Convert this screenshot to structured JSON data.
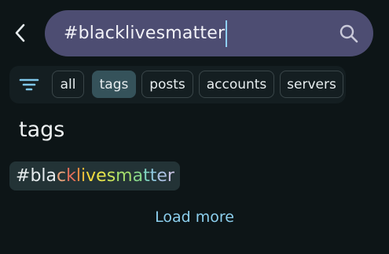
{
  "search": {
    "query": "#blacklivesmatter"
  },
  "filters": {
    "items": [
      {
        "label": "all",
        "selected": false
      },
      {
        "label": "tags",
        "selected": true
      },
      {
        "label": "posts",
        "selected": false
      },
      {
        "label": "accounts",
        "selected": false
      },
      {
        "label": "servers",
        "selected": false
      }
    ]
  },
  "section": {
    "heading": "tags"
  },
  "tag_result": {
    "label": "#blacklivesmatter",
    "letter_colors": [
      "#e6ecee",
      "#e6ecee",
      "#e6ecee",
      "#e6ecee",
      "#e8a37c",
      "#e46f5b",
      "#f08a43",
      "#f4bd39",
      "#f2d73c",
      "#e6e24a",
      "#c8e25a",
      "#a3dc6c",
      "#87d68a",
      "#7fd3c0",
      "#8fc7dd",
      "#a9bfe0",
      "#c8c4e4"
    ]
  },
  "load_more": {
    "label": "Load more"
  },
  "colors": {
    "background": "#0d1517",
    "search_box": "#4d4d72",
    "accent": "#8ccfee",
    "chip_selected": "#35525a"
  }
}
